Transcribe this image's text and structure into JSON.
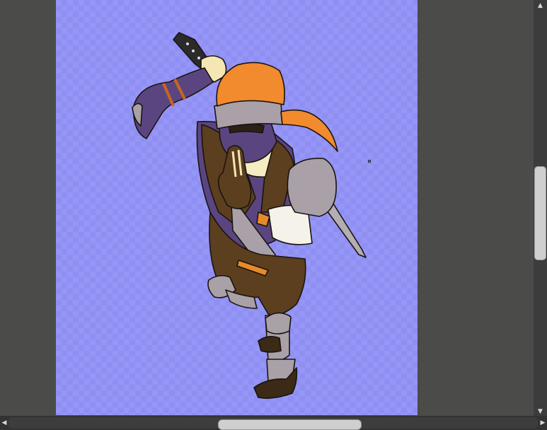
{
  "workspace": {
    "background_color": "#4b4b49",
    "canvas_background": "#9696f6",
    "artwork": "ninja-character-illustration"
  },
  "scrollbars": {
    "vertical": {
      "up_arrow": "▲",
      "down_arrow": "▼"
    },
    "horizontal": {
      "left_arrow": "◀",
      "right_arrow": "▶"
    }
  }
}
